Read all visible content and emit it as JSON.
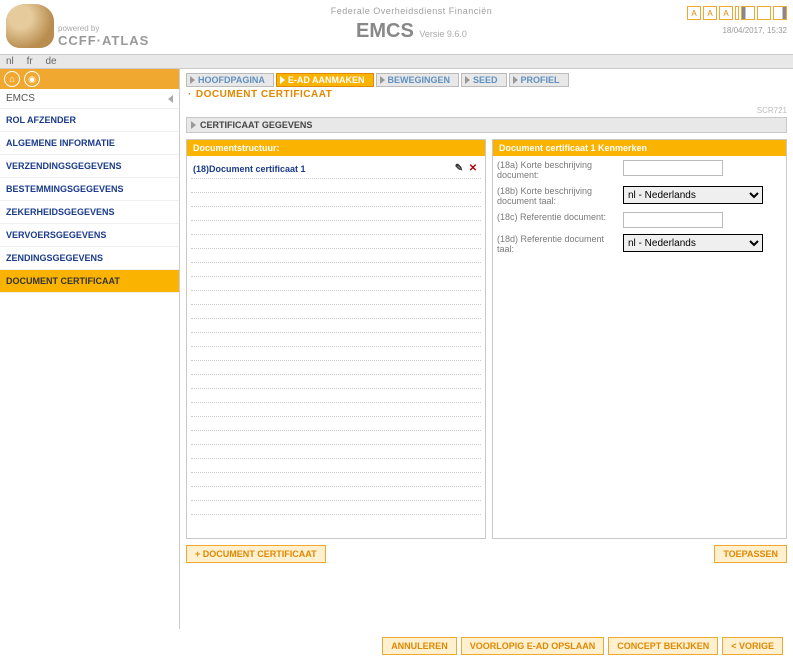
{
  "header": {
    "powered_by": "powered by",
    "brand": "CCFF·ATLAS",
    "agency": "Federale Overheidsdienst Financiën",
    "app": "EMCS",
    "version": "Versie 9.6.0",
    "timestamp": "18/04/2017, 15:32",
    "util_a": "A"
  },
  "langs": [
    "nl",
    "fr",
    "de"
  ],
  "sidebar": {
    "app_name": "EMCS",
    "items": [
      {
        "label": "ROL AFZENDER"
      },
      {
        "label": "ALGEMENE INFORMATIE"
      },
      {
        "label": "VERZENDINGSGEGEVENS"
      },
      {
        "label": "BESTEMMINGSGEGEVENS"
      },
      {
        "label": "ZEKERHEIDSGEGEVENS"
      },
      {
        "label": "VERVOERSGEGEVENS"
      },
      {
        "label": "ZENDINGSGEGEVENS"
      },
      {
        "label": "DOCUMENT CERTIFICAAT"
      }
    ]
  },
  "tabs": [
    {
      "label": "HOOFDPAGINA"
    },
    {
      "label": "E-AD AANMAKEN"
    },
    {
      "label": "BEWEGINGEN"
    },
    {
      "label": "SEED"
    },
    {
      "label": "PROFIEL"
    }
  ],
  "breadcrumb": "DOCUMENT CERTIFICAAT",
  "screen_id": "SCR721",
  "section_title": "CERTIFICAAT GEGEVENS",
  "left_panel": {
    "title": "Documentstructuur:",
    "row": "(18)Document certificaat 1"
  },
  "right_panel": {
    "title": "Document certificaat  1  Kenmerken",
    "f1": {
      "label": "(18a) Korte beschrijving document:",
      "value": ""
    },
    "f2": {
      "label": "(18b) Korte beschrijving document taal:",
      "selected": "nl - Nederlands",
      "options": [
        "nl - Nederlands"
      ]
    },
    "f3": {
      "label": "(18c) Referentie document:",
      "value": ""
    },
    "f4": {
      "label": "(18d) Referentie document taal:",
      "selected": "nl - Nederlands",
      "options": [
        "nl - Nederlands"
      ]
    }
  },
  "buttons": {
    "add": "+ DOCUMENT CERTIFICAAT",
    "apply": "TOEPASSEN",
    "cancel": "ANNULEREN",
    "save": "VOORLOPIG E-AD OPSLAAN",
    "preview": "CONCEPT BEKIJKEN",
    "prev": "<  VORIGE"
  }
}
